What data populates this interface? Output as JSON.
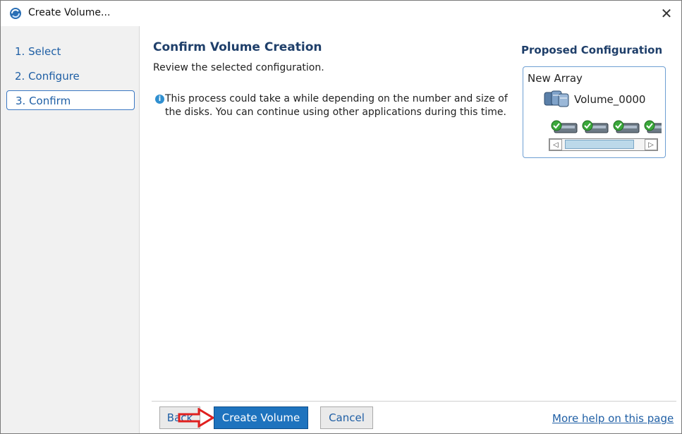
{
  "window": {
    "title": "Create Volume...",
    "close_glyph": "✕"
  },
  "sidebar": {
    "steps": [
      {
        "label": "1. Select"
      },
      {
        "label": "2. Configure"
      },
      {
        "label": "3. Confirm",
        "active": true
      }
    ]
  },
  "main": {
    "title": "Confirm Volume Creation",
    "subtitle": "Review the selected configuration.",
    "info_icon": "i",
    "info_text": "This process could take a while depending on the number and size of the disks. You can continue using other applications during this time."
  },
  "proposed": {
    "title": "Proposed Configuration",
    "array_label": "New Array",
    "volume_label": "Volume_0000",
    "disk_count_visible": 4
  },
  "footer": {
    "back_label": "Back",
    "create_label": "Create Volume",
    "cancel_label": "Cancel",
    "help_link": "More help on this page"
  },
  "colors": {
    "primary_button": "#1e73be",
    "link": "#1f5fa5",
    "heading": "#1f3f6a",
    "annotation_arrow": "#e0201f"
  }
}
